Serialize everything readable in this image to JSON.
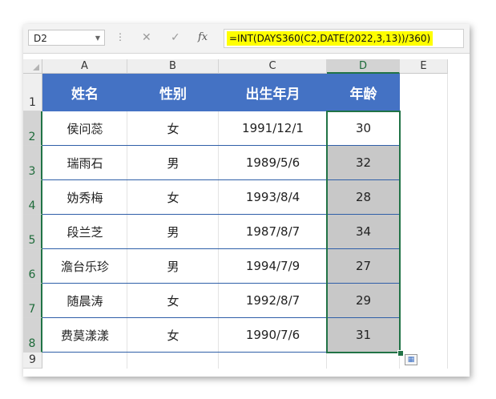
{
  "namebox": "D2",
  "formula_buttons": {
    "cancel": "✕",
    "confirm": "✓",
    "fx": "fx"
  },
  "formula": "=INT(DAYS360(C2,DATE(2022,3,13))/360)",
  "columns": [
    "A",
    "B",
    "C",
    "D",
    "E"
  ],
  "rows": [
    "1",
    "2",
    "3",
    "4",
    "5",
    "6",
    "7",
    "8",
    "9"
  ],
  "header": [
    "姓名",
    "性别",
    "出生年月",
    "年龄"
  ],
  "table": [
    [
      "侯问蕊",
      "女",
      "1991/12/1",
      "30"
    ],
    [
      "瑞雨石",
      "男",
      "1989/5/6",
      "32"
    ],
    [
      "妫秀梅",
      "女",
      "1993/8/4",
      "28"
    ],
    [
      "段兰芝",
      "男",
      "1987/8/7",
      "34"
    ],
    [
      "澹台乐珍",
      "男",
      "1994/7/9",
      "27"
    ],
    [
      "随晨涛",
      "女",
      "1992/8/7",
      "29"
    ],
    [
      "费莫漾漾",
      "女",
      "1990/7/6",
      "31"
    ]
  ],
  "colors": {
    "header_fill": "#4472c4",
    "selected_fill": "#c8c8c8",
    "selection_border": "#217346",
    "formula_highlight": "#ffff00"
  }
}
